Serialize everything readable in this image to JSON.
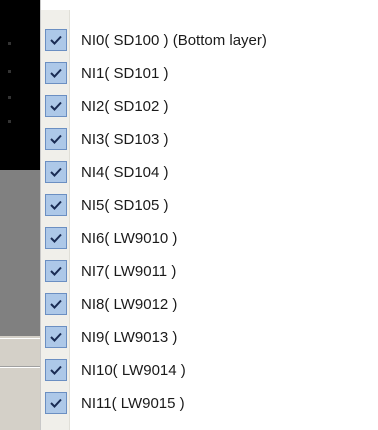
{
  "menu": {
    "items": [
      {
        "label": "NI0( SD100 ) (Bottom layer)",
        "checked": true
      },
      {
        "label": "NI1( SD101 )",
        "checked": true
      },
      {
        "label": "NI2( SD102 )",
        "checked": true
      },
      {
        "label": "NI3( SD103 )",
        "checked": true
      },
      {
        "label": "NI4( SD104 )",
        "checked": true
      },
      {
        "label": "NI5( SD105 )",
        "checked": true
      },
      {
        "label": "NI6( LW9010 )",
        "checked": true
      },
      {
        "label": "NI7( LW9011 )",
        "checked": true
      },
      {
        "label": "NI8( LW9012 )",
        "checked": true
      },
      {
        "label": "NI9( LW9013 )",
        "checked": true
      },
      {
        "label": "NI10( LW9014 )",
        "checked": true
      },
      {
        "label": "NI11( LW9015 )",
        "checked": true
      }
    ]
  },
  "colors": {
    "check_fill": "#adc8e8",
    "check_border": "#6b8fc2",
    "checkmark": "#1a2c54"
  }
}
